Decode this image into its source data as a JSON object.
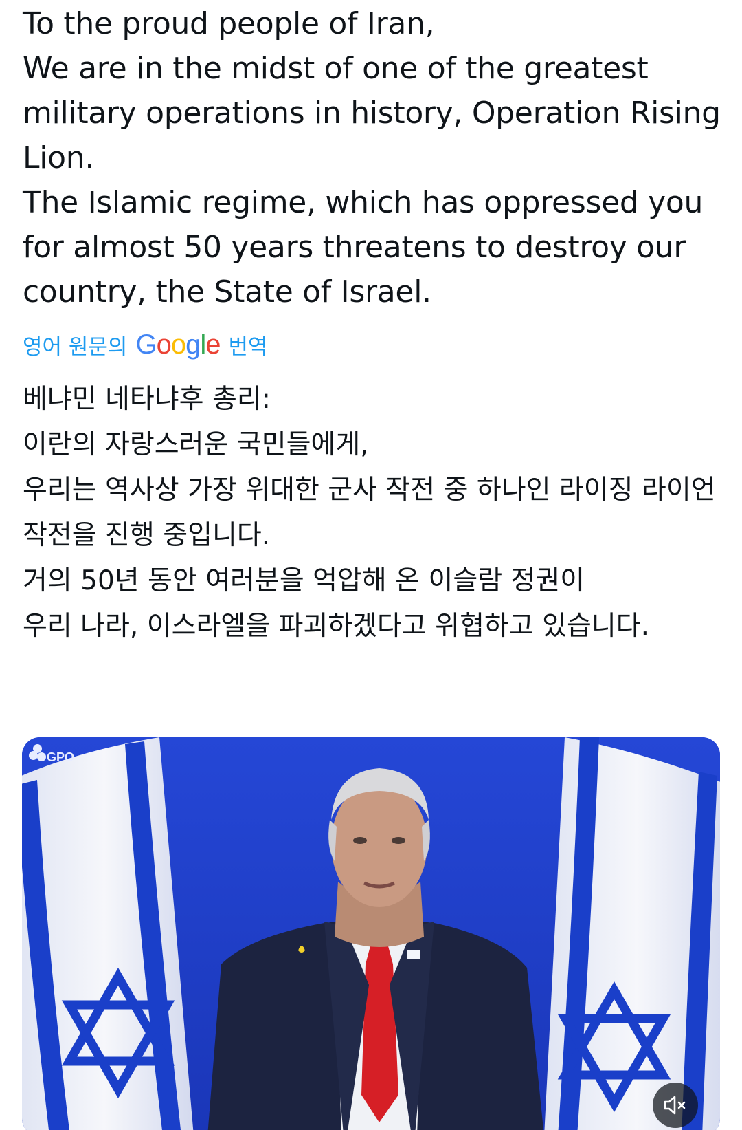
{
  "post": {
    "original_lines": [
      "To the proud people of Iran,",
      "We are in the midst of one of the greatest military operations in history, Operation Rising Lion.",
      "The Islamic regime, which has oppressed you for almost 50 years threatens to destroy our country, the State of Israel."
    ],
    "translation_note": {
      "prefix": "영어 원문의",
      "google_letters": [
        "G",
        "o",
        "o",
        "g",
        "l",
        "e"
      ],
      "suffix": "번역"
    },
    "translated_lines": [
      "베냐민 네타냐후 총리:",
      "이란의 자랑스러운 국민들에게,",
      "우리는 역사상 가장 위대한 군사 작전 중 하나인 라이징 라이언 작전을 진행 중입니다.",
      "거의 50년 동안 여러분을 억압해 온 이슬람 정권이",
      "우리 나라, 이스라엘을 파괴하겠다고 위협하고 있습니다."
    ]
  },
  "media": {
    "watermark": "GPO",
    "mute_icon": "speaker-muted-icon",
    "colors": {
      "background": "#1f3fd0",
      "flag_blue": "#1a3fc9",
      "flag_white": "#f3f5fb",
      "suit": "#1c2340",
      "tie": "#d61f26",
      "shirt": "#f0f2f6",
      "skin": "#c99a82"
    }
  },
  "colors": {
    "text": "#0f1419",
    "link": "#1d9bf0"
  }
}
